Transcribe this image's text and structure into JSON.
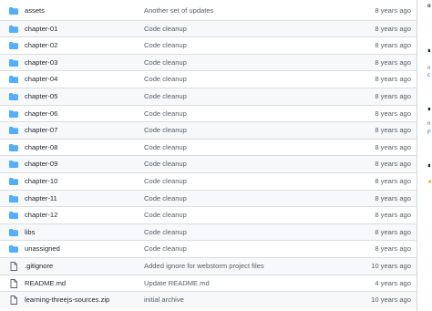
{
  "files": [
    {
      "type": "folder",
      "name": "assets",
      "message": "Another set of updates",
      "age": "8 years ago"
    },
    {
      "type": "folder",
      "name": "chapter-01",
      "message": "Code cleanup",
      "age": "8 years ago"
    },
    {
      "type": "folder",
      "name": "chapter-02",
      "message": "Code cleanup",
      "age": "8 years ago"
    },
    {
      "type": "folder",
      "name": "chapter-03",
      "message": "Code cleanup",
      "age": "8 years ago"
    },
    {
      "type": "folder",
      "name": "chapter-04",
      "message": "Code cleanup",
      "age": "8 years ago"
    },
    {
      "type": "folder",
      "name": "chapter-05",
      "message": "Code cleanup",
      "age": "8 years ago"
    },
    {
      "type": "folder",
      "name": "chapter-06",
      "message": "Code cleanup",
      "age": "8 years ago"
    },
    {
      "type": "folder",
      "name": "chapter-07",
      "message": "Code cleanup",
      "age": "8 years ago"
    },
    {
      "type": "folder",
      "name": "chapter-08",
      "message": "Code cleanup",
      "age": "8 years ago"
    },
    {
      "type": "folder",
      "name": "chapter-09",
      "message": "Code cleanup",
      "age": "8 years ago"
    },
    {
      "type": "folder",
      "name": "chapter-10",
      "message": "Code cleanup",
      "age": "8 years ago"
    },
    {
      "type": "folder",
      "name": "chapter-11",
      "message": "Code cleanup",
      "age": "8 years ago"
    },
    {
      "type": "folder",
      "name": "chapter-12",
      "message": "Code cleanup",
      "age": "8 years ago"
    },
    {
      "type": "folder",
      "name": "libs",
      "message": "Code cleanup",
      "age": "8 years ago"
    },
    {
      "type": "folder",
      "name": "unassigned",
      "message": "Code cleanup",
      "age": "8 years ago"
    },
    {
      "type": "file",
      "name": ".gitignore",
      "message": "Added ignore for webstorm project files",
      "age": "10 years ago"
    },
    {
      "type": "file",
      "name": "README.md",
      "message": "Update README.md",
      "age": "4 years ago"
    },
    {
      "type": "file",
      "name": "learning-threejs-sources.zip",
      "message": "initial archive",
      "age": "10 years ago"
    }
  ],
  "colors": {
    "folder_icon": "#54aeff",
    "file_icon": "#57606a",
    "row_alt_bg": "#f6f8fa",
    "border": "#d0d7de"
  },
  "sidebar_fragments": [
    {
      "text": "o",
      "style": "dark"
    },
    {
      "text": "∎",
      "style": "dark"
    },
    {
      "text": "n",
      "style": ""
    },
    {
      "text": "c",
      "style": "blue"
    },
    {
      "text": "∎",
      "style": "dark"
    },
    {
      "text": "n",
      "style": ""
    },
    {
      "text": "F",
      "style": "blue"
    },
    {
      "text": "∎",
      "style": "dark"
    },
    {
      "text": "★",
      "style": "yellow"
    }
  ]
}
